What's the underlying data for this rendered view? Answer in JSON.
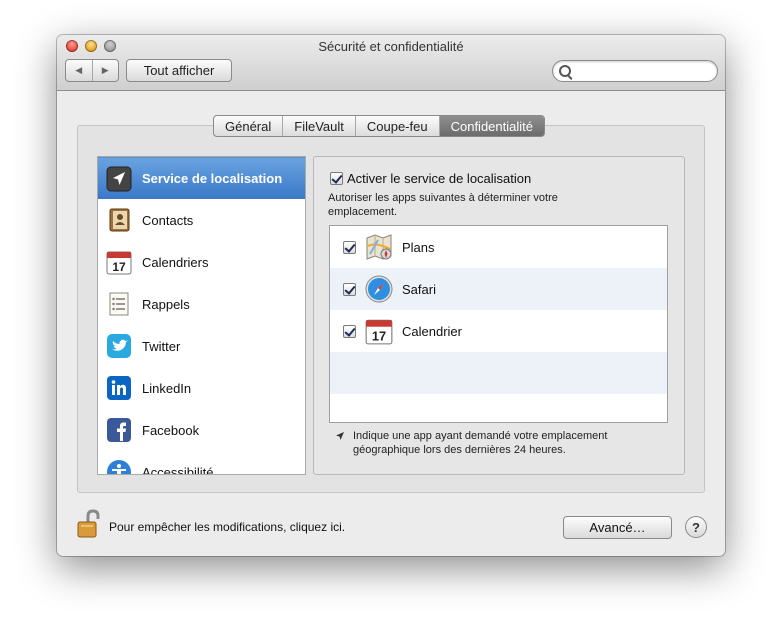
{
  "window": {
    "title": "Sécurité et confidentialité",
    "show_all_label": "Tout afficher",
    "back_glyph": "◀",
    "forward_glyph": "▶",
    "search_placeholder": ""
  },
  "tabs": [
    {
      "label": "Général",
      "active": false
    },
    {
      "label": "FileVault",
      "active": false
    },
    {
      "label": "Coupe-feu",
      "active": false
    },
    {
      "label": "Confidentialité",
      "active": true
    }
  ],
  "sidebar": {
    "items": [
      {
        "label": "Service de localisation",
        "icon": "location-arrow-icon",
        "selected": true
      },
      {
        "label": "Contacts",
        "icon": "contacts-book-icon"
      },
      {
        "label": "Calendriers",
        "icon": "calendar-icon"
      },
      {
        "label": "Rappels",
        "icon": "reminders-list-icon"
      },
      {
        "label": "Twitter",
        "icon": "twitter-bird-icon"
      },
      {
        "label": "LinkedIn",
        "icon": "linkedin-icon"
      },
      {
        "label": "Facebook",
        "icon": "facebook-icon"
      },
      {
        "label": "Accessibilité",
        "icon": "accessibility-icon"
      }
    ]
  },
  "location": {
    "enable_label": "Activer le service de localisation",
    "enable_checked": true,
    "description": "Autoriser les apps suivantes à déterminer votre emplacement.",
    "apps": [
      {
        "name": "Plans",
        "icon": "maps-icon",
        "checked": true
      },
      {
        "name": "Safari",
        "icon": "safari-compass-icon",
        "checked": true
      },
      {
        "name": "Calendrier",
        "icon": "calendar-icon",
        "checked": true
      }
    ],
    "calendar_day": "17",
    "footnote": "Indique une app ayant demandé votre emplacement géographique lors des dernières 24 heures."
  },
  "footer": {
    "lock_label": "Pour empêcher les modifications, cliquez ici.",
    "advanced_label": "Avancé…",
    "help_label": "?"
  },
  "colors": {
    "selection": "#3a78c8",
    "twitter": "#2aa9e0",
    "linkedin": "#0a66c2",
    "facebook": "#3b5998"
  }
}
